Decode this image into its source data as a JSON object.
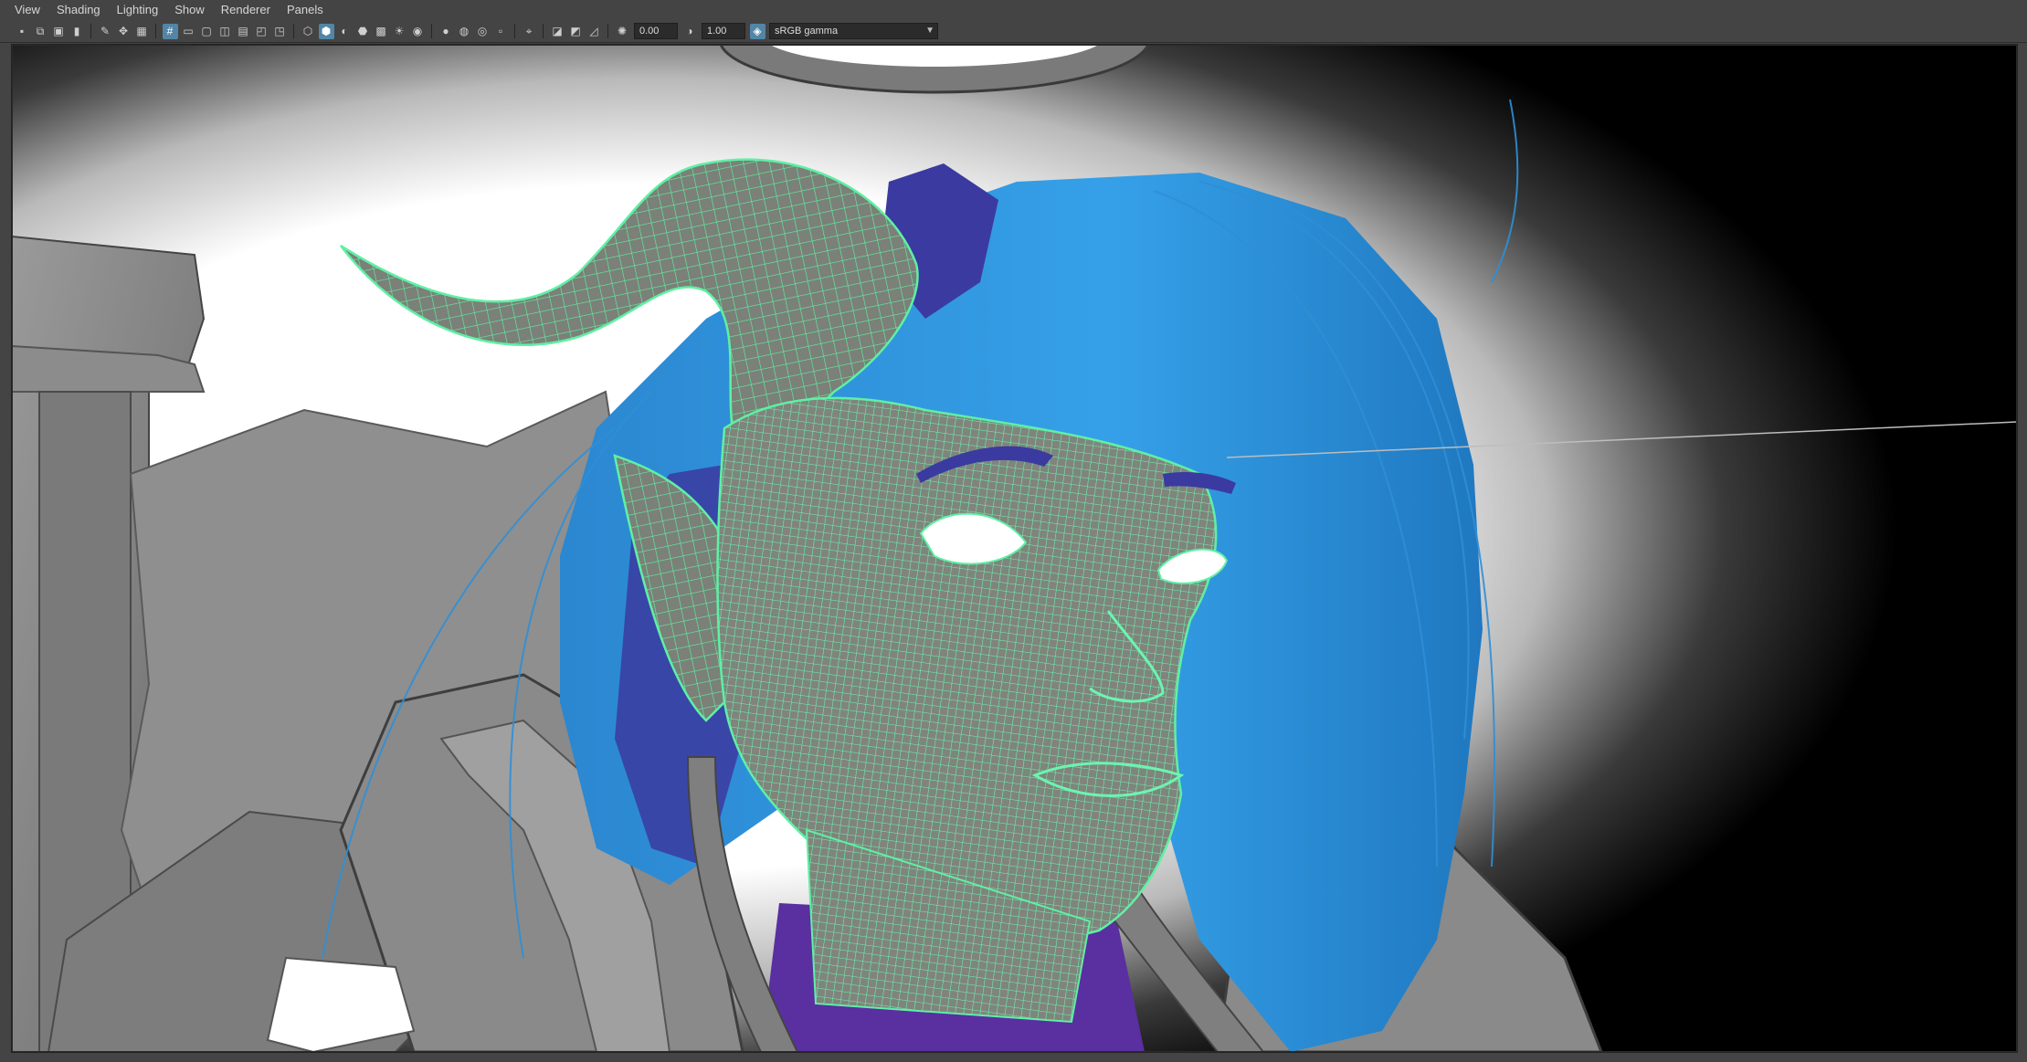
{
  "menubar": {
    "items": [
      "View",
      "Shading",
      "Lighting",
      "Show",
      "Renderer",
      "Panels"
    ]
  },
  "toolbar": {
    "exposure_value": "0.00",
    "gamma_value": "1.00",
    "color_space": "sRGB gamma",
    "icons": [
      "camera-icon",
      "camera-attributes-icon",
      "bookmark-icon",
      "image-plane-icon",
      "grease-pencil-icon",
      "grid-icon",
      "film-gate-icon",
      "resolution-gate-icon",
      "gate-mask-icon",
      "field-chart-icon",
      "safe-action-icon",
      "safe-title-icon",
      "wireframe-icon",
      "smooth-shade-icon",
      "default-material-icon",
      "wireframe-on-shaded-icon",
      "textured-icon",
      "use-all-lights-icon",
      "shadows-icon",
      "screen-space-ao-icon",
      "motion-blur-icon",
      "multisample-aa-icon",
      "depth-of-field-icon",
      "isolate-select-icon",
      "xray-icon",
      "xray-joints-icon",
      "xray-components-icon"
    ],
    "colors": {
      "active": "#5285a6",
      "bar": "#444444"
    }
  },
  "viewport": {
    "colors": {
      "background": "#000000",
      "gradient_light": "#ffffff",
      "mesh_gray": "#8a8a8a",
      "wireframe": "#5ff0a4",
      "hair": "#2f8fd6",
      "hair_dark": "#3b3aa0",
      "shirt": "#5a2fa0"
    }
  }
}
